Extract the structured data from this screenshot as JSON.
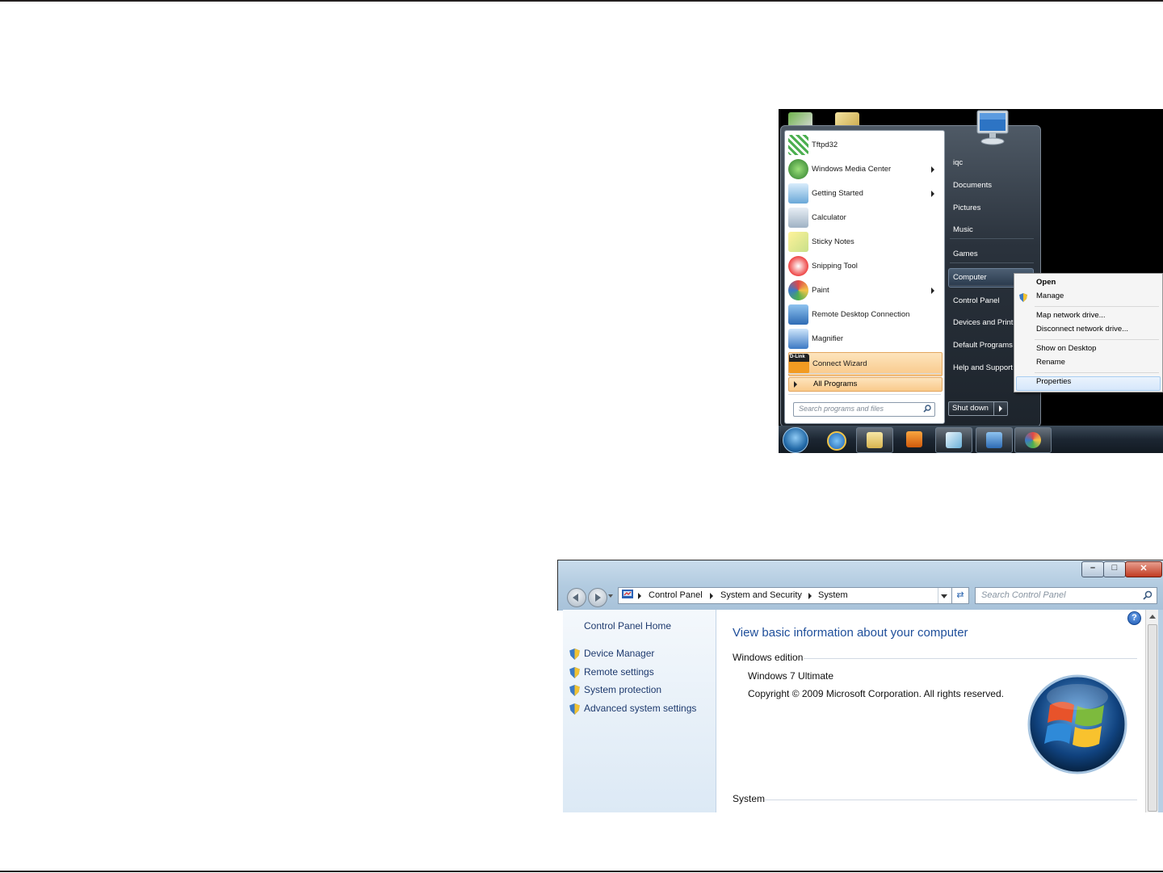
{
  "start_menu": {
    "programs": [
      {
        "label": "Tftpd32",
        "icon": "tftpd32-icon",
        "submenu": false
      },
      {
        "label": "Windows Media Center",
        "icon": "windows-media-center-icon",
        "submenu": true
      },
      {
        "label": "Getting Started",
        "icon": "getting-started-icon",
        "submenu": true
      },
      {
        "label": "Calculator",
        "icon": "calculator-icon",
        "submenu": false
      },
      {
        "label": "Sticky Notes",
        "icon": "sticky-notes-icon",
        "submenu": false
      },
      {
        "label": "Snipping Tool",
        "icon": "snipping-tool-icon",
        "submenu": false
      },
      {
        "label": "Paint",
        "icon": "paint-icon",
        "submenu": true
      },
      {
        "label": "Remote Desktop Connection",
        "icon": "remote-desktop-icon",
        "submenu": false
      },
      {
        "label": "Magnifier",
        "icon": "magnifier-icon",
        "submenu": false
      },
      {
        "label": "Connect Wizard",
        "icon": "dlink-icon",
        "submenu": false,
        "highlighted": true
      }
    ],
    "dlink_icon_text": "D-Link",
    "all_programs": "All Programs",
    "search_placeholder": "Search programs and files",
    "right_links": [
      "iqc",
      "Documents",
      "Pictures",
      "Music",
      "Games",
      "Computer",
      "Control Panel",
      "Devices and Printers",
      "Default Programs",
      "Help and Support"
    ],
    "shutdown": "Shut down"
  },
  "context_menu": {
    "items": [
      "Open",
      "Manage",
      "Map network drive...",
      "Disconnect network drive...",
      "Show on Desktop",
      "Rename",
      "Properties"
    ]
  },
  "taskbar": {
    "items": [
      "start-orb",
      "internet-explorer-icon",
      "file-explorer-icon",
      "media-player-icon",
      "notepad-icon",
      "remote-desktop-icon",
      "paint-icon"
    ]
  },
  "system_window": {
    "breadcrumbs": [
      "Control Panel",
      "System and Security",
      "System"
    ],
    "search_placeholder": "Search Control Panel",
    "sidebar": {
      "home": "Control Panel Home",
      "links": [
        "Device Manager",
        "Remote settings",
        "System protection",
        "Advanced system settings"
      ]
    },
    "title": "View basic information about your computer",
    "edition_heading": "Windows edition",
    "edition": "Windows 7 Ultimate",
    "copyright": "Copyright © 2009 Microsoft Corporation.  All rights reserved.",
    "system_heading": "System",
    "help_glyph": "?"
  },
  "colors": {
    "highlight_orange": "#f9c98a",
    "link_blue": "#1e3a6e",
    "title_blue": "#1e4e9a"
  }
}
